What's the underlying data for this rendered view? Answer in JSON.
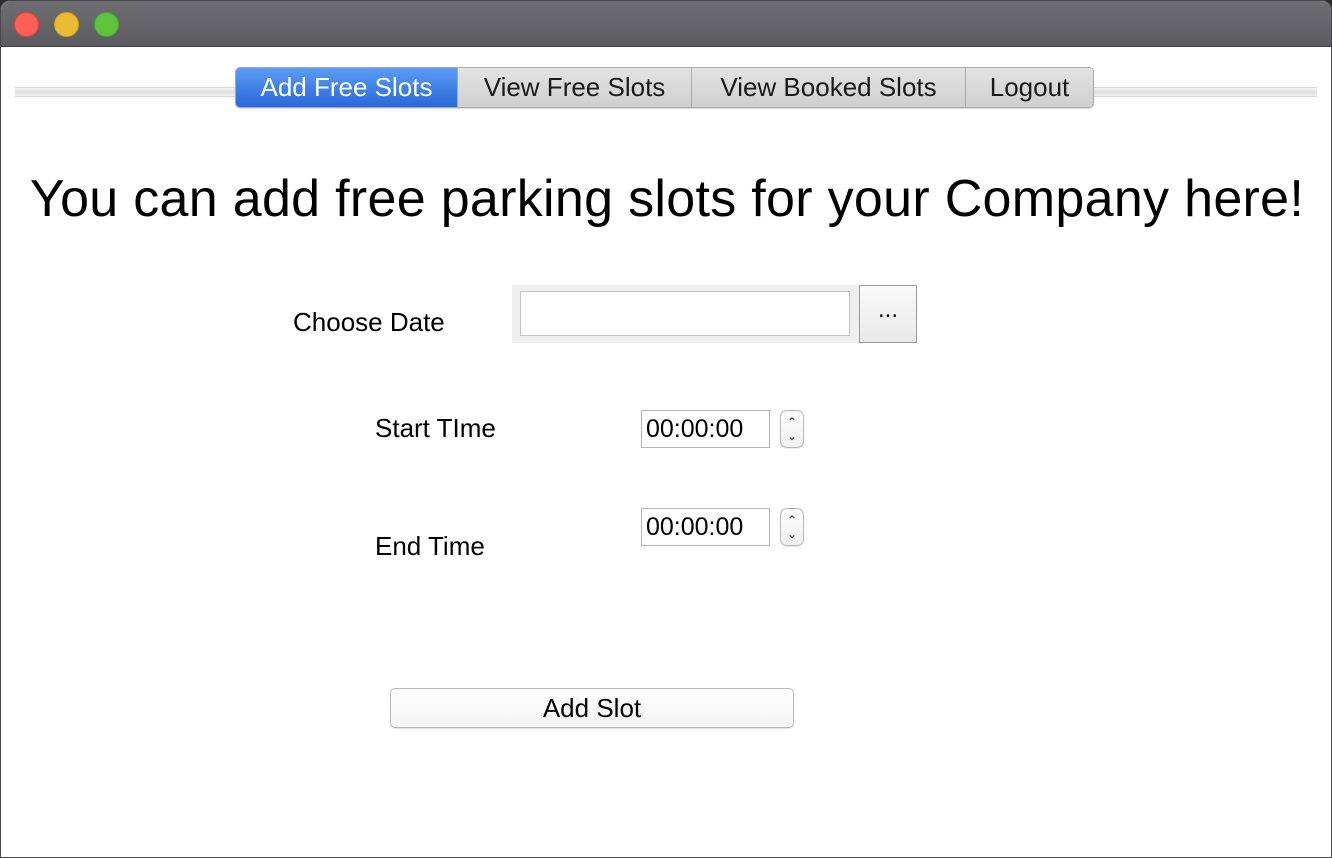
{
  "window": {
    "controls": [
      "close",
      "minimize",
      "maximize"
    ]
  },
  "tabs": [
    {
      "label": "Add Free Slots",
      "active": true
    },
    {
      "label": "View Free Slots",
      "active": false
    },
    {
      "label": "View Booked Slots",
      "active": false
    },
    {
      "label": "Logout",
      "active": false
    }
  ],
  "heading": "You can add free parking slots for your Company here!",
  "form": {
    "date_label": "Choose Date",
    "date_value": "",
    "date_button_label": "...",
    "start_label": "Start TIme",
    "start_value": "00:00:00",
    "end_label": "End Time",
    "end_value": "00:00:00",
    "submit_label": "Add Slot"
  },
  "colors": {
    "active_tab": "#2f6fdc",
    "close": "#fe5f57",
    "minimize": "#e8bb32",
    "maximize": "#5fc33b"
  },
  "icons": {
    "spinner_up": "chevron-up-icon",
    "spinner_down": "chevron-down-icon"
  }
}
